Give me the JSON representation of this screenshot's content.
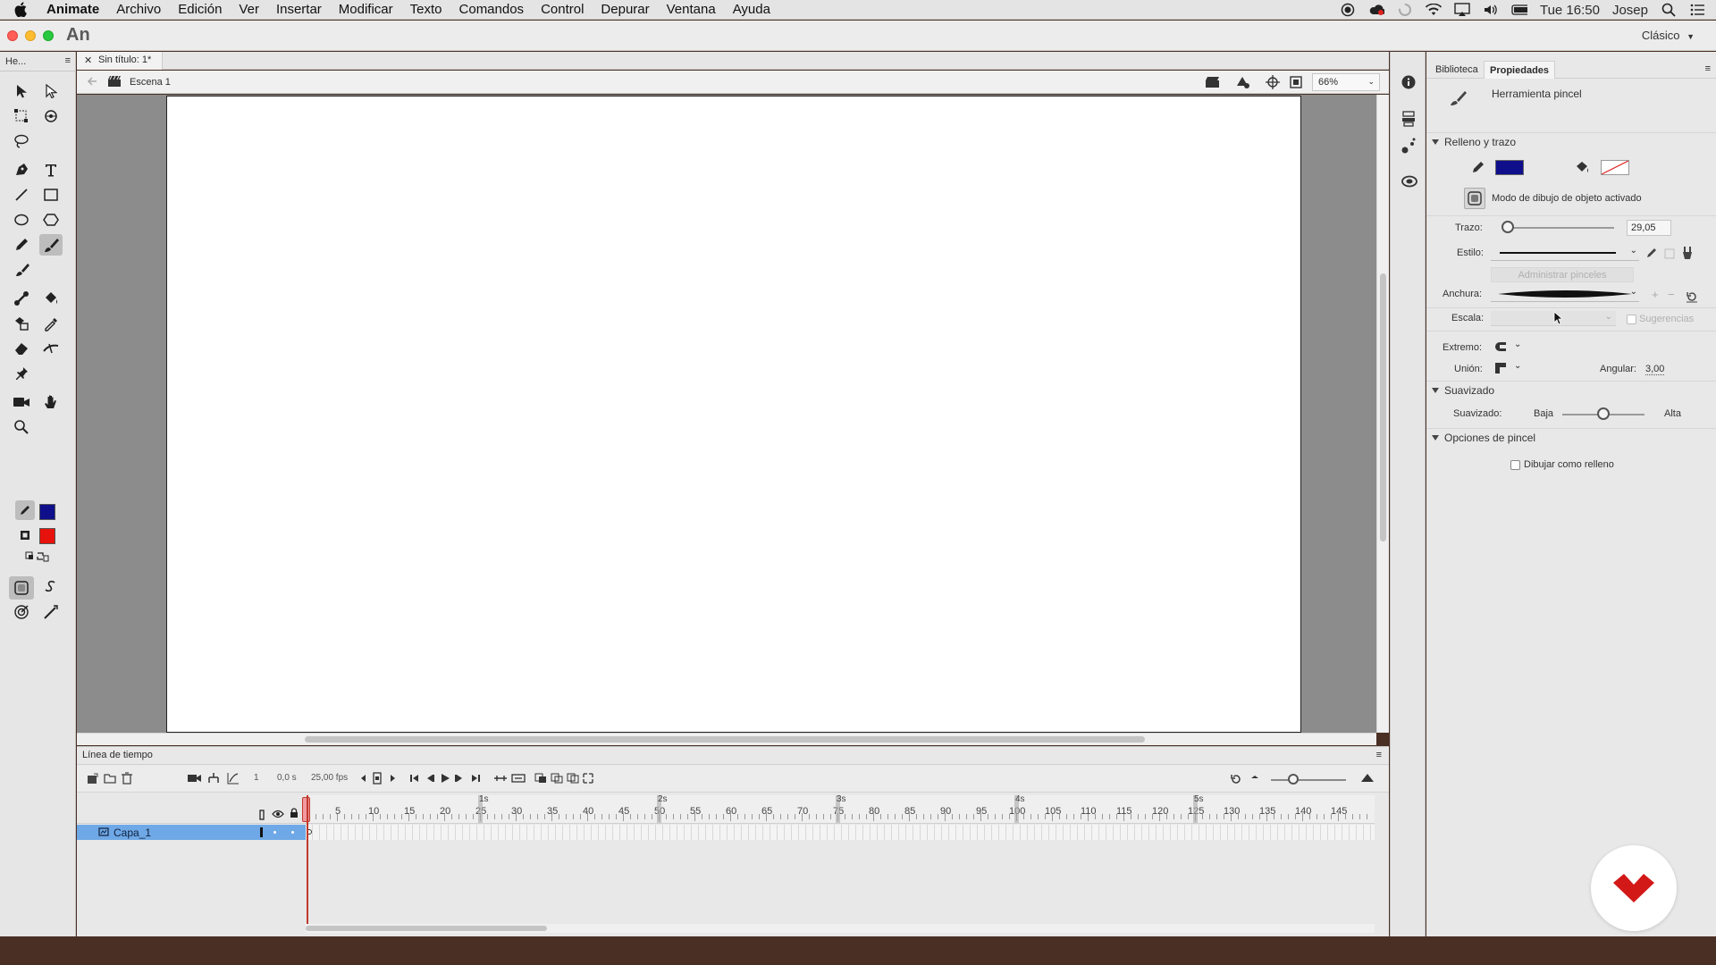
{
  "menubar": {
    "items": [
      "Animate",
      "Archivo",
      "Edición",
      "Ver",
      "Insertar",
      "Modificar",
      "Texto",
      "Comandos",
      "Control",
      "Depurar",
      "Ventana",
      "Ayuda"
    ],
    "clock": "Tue 16:50",
    "user": "Josep"
  },
  "app": {
    "name": "An",
    "workspace": "Clásico"
  },
  "tools_panel": {
    "title": "He..."
  },
  "document": {
    "tab_title": "Sin título: 1*",
    "scene": "Escena 1",
    "zoom": "66%"
  },
  "timeline": {
    "title": "Línea de tiempo",
    "current_frame": "1",
    "time": "0,0 s",
    "fps": "25,00 fps",
    "frame_labels": [
      "5",
      "10",
      "15",
      "20",
      "25",
      "30",
      "35",
      "40",
      "45",
      "50",
      "55",
      "60",
      "65",
      "70",
      "75",
      "80",
      "85",
      "90",
      "95",
      "100",
      "105",
      "110",
      "115",
      "120",
      "125",
      "130",
      "135",
      "140",
      "145"
    ],
    "second_labels": [
      "1s",
      "2s",
      "3s",
      "4s",
      "5s"
    ],
    "layer_name": "Capa_1"
  },
  "properties": {
    "tab_library": "Biblioteca",
    "tab_properties": "Propiedades",
    "tool_name": "Herramienta pincel",
    "fill_stroke_section": "Relleno y trazo",
    "stroke_color": "#0f0f8c",
    "object_draw_mode": "Modo de dibujo de objeto activado",
    "stroke_label": "Trazo:",
    "stroke_value": "29,05",
    "stroke_slider_fraction": 0.05,
    "style_label": "Estilo:",
    "manage_brushes": "Administrar pinceles",
    "width_label": "Anchura:",
    "scale_label": "Escala:",
    "hints_label": "Sugerencias",
    "cap_label": "Extremo:",
    "join_label": "Unión:",
    "angular_label": "Angular:",
    "angular_value": "3,00",
    "smoothing_section": "Suavizado",
    "smoothing_label": "Suavizado:",
    "smoothing_low": "Baja",
    "smoothing_high": "Alta",
    "smoothing_fraction": 0.5,
    "brush_options_section": "Opciones de pincel",
    "draw_as_fill": "Dibujar como relleno"
  },
  "tool_colors": {
    "stroke": "#0f0f8c",
    "fill": "#e8120c"
  }
}
